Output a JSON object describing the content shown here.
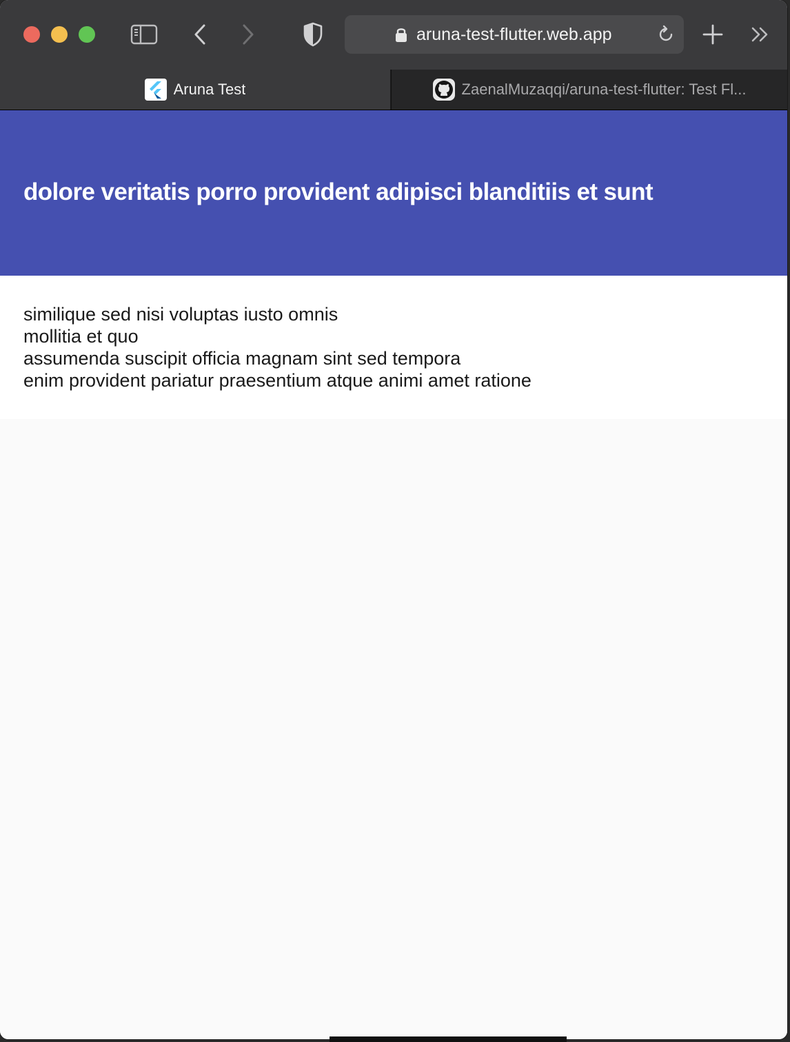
{
  "browser": {
    "url": "aruna-test-flutter.web.app",
    "tabs": [
      {
        "label": "Aruna Test",
        "favicon": "flutter-icon",
        "active": true
      },
      {
        "label": "ZaenalMuzaqqi/aruna-test-flutter: Test Fl...",
        "favicon": "github-icon",
        "active": false
      }
    ]
  },
  "app": {
    "title": "dolore veritatis porro provident adipisci blanditiis et sunt",
    "body_lines": [
      "similique sed nisi voluptas iusto omnis",
      "mollitia et quo",
      "assumenda suscipit officia magnam sint sed tempora",
      "enim provident pariatur praesentium atque animi amet ratione"
    ],
    "app_bar_color": "#4550b0"
  }
}
